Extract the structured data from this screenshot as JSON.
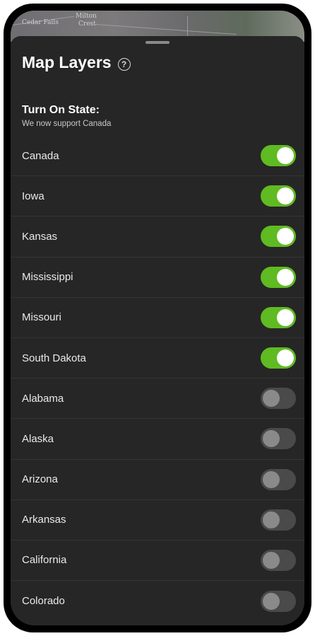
{
  "map": {
    "label_left": "Cedar Falls",
    "label_center_top": "Milton",
    "label_center_bottom": "Crest"
  },
  "header": {
    "title": "Map Layers",
    "help_icon": "question-circle-icon"
  },
  "section": {
    "title": "Turn On State:",
    "subtitle": "We now support Canada"
  },
  "colors": {
    "toggle_on": "#5fbb21",
    "toggle_off": "#4a4a4a",
    "sheet_bg": "#262626"
  },
  "states": [
    {
      "label": "Canada",
      "on": true
    },
    {
      "label": "Iowa",
      "on": true
    },
    {
      "label": "Kansas",
      "on": true
    },
    {
      "label": "Mississippi",
      "on": true
    },
    {
      "label": "Missouri",
      "on": true
    },
    {
      "label": "South Dakota",
      "on": true
    },
    {
      "label": "Alabama",
      "on": false
    },
    {
      "label": "Alaska",
      "on": false
    },
    {
      "label": "Arizona",
      "on": false
    },
    {
      "label": "Arkansas",
      "on": false
    },
    {
      "label": "California",
      "on": false
    },
    {
      "label": "Colorado",
      "on": false
    }
  ]
}
